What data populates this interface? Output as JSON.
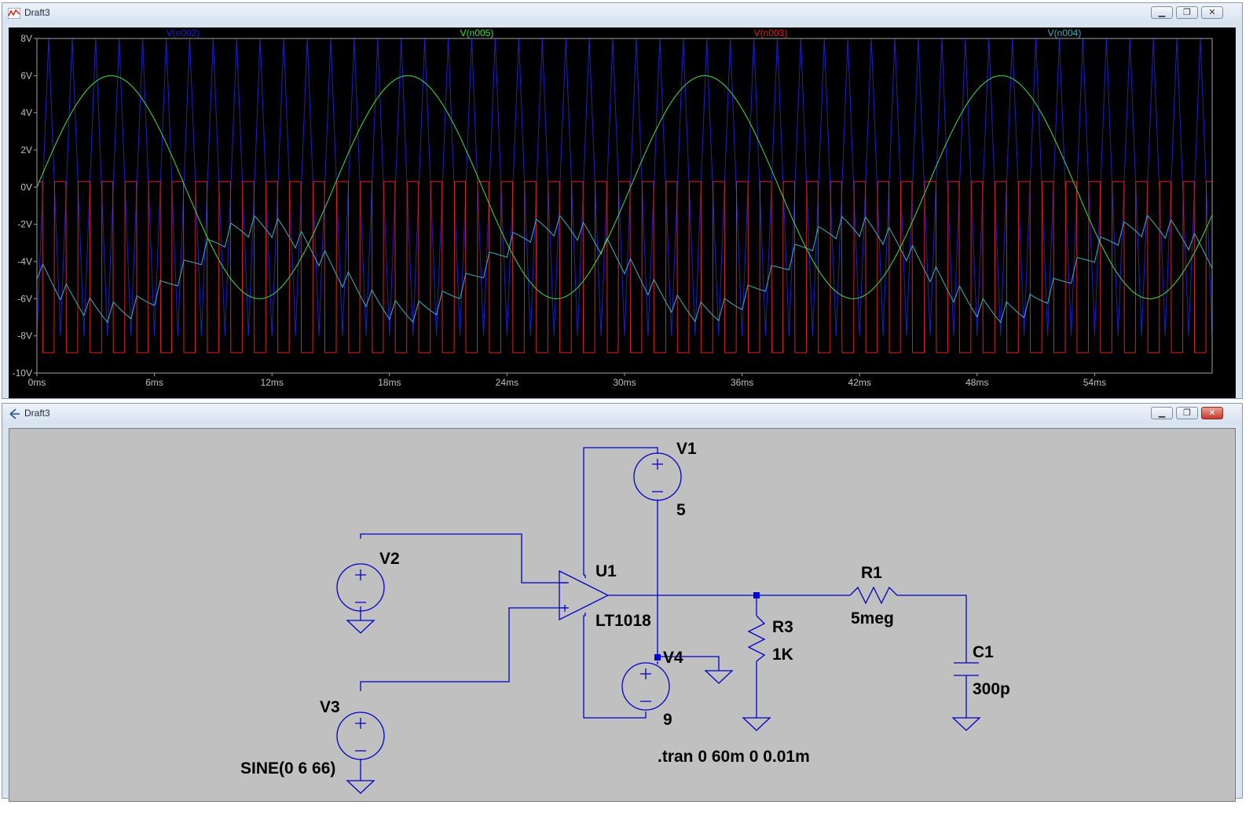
{
  "waveform_window": {
    "title": "Draft3",
    "traces": [
      {
        "name": "V(n002)",
        "color": "#2020c8"
      },
      {
        "name": "V(n005)",
        "color": "#40e040"
      },
      {
        "name": "V(n003)",
        "color": "#e02020"
      },
      {
        "name": "V(n004)",
        "color": "#40b0c0"
      }
    ],
    "y_ticks": [
      "8V",
      "6V",
      "4V",
      "2V",
      "0V",
      "-2V",
      "-4V",
      "-6V",
      "-8V",
      "-10V"
    ],
    "x_ticks": [
      "0ms",
      "6ms",
      "12ms",
      "18ms",
      "24ms",
      "30ms",
      "36ms",
      "42ms",
      "48ms",
      "54ms"
    ]
  },
  "chart_data": {
    "type": "line",
    "x_unit": "ms",
    "y_unit": "V",
    "xlim": [
      0,
      60
    ],
    "ylim": [
      -10,
      8
    ],
    "grid": false,
    "series": [
      {
        "name": "V(n002)",
        "description": "triangle",
        "min": -8,
        "max": 8,
        "period_ms": 1.2
      },
      {
        "name": "V(n005)",
        "description": "sine",
        "amplitude": 6,
        "frequency_hz": 66
      },
      {
        "name": "V(n003)",
        "description": "square",
        "low": -8.9,
        "high": 0.3,
        "period_ms": 1.2
      },
      {
        "name": "V(n004)",
        "description": "filtered sawtooth",
        "min": -7.5,
        "max": -1.3
      }
    ]
  },
  "schematic_window": {
    "title": "Draft3",
    "components": {
      "V1": {
        "label": "V1",
        "value": "5"
      },
      "V2": {
        "label": "V2"
      },
      "V3": {
        "label": "V3",
        "value": "SINE(0 6 66)"
      },
      "V4": {
        "label": "V4",
        "value": "9"
      },
      "U1": {
        "label": "U1",
        "value": "LT1018"
      },
      "R1": {
        "label": "R1",
        "value": "5meg"
      },
      "R3": {
        "label": "R3",
        "value": "1K"
      },
      "C1": {
        "label": "C1",
        "value": "300p"
      }
    },
    "directive": ".tran 0 60m 0 0.01m"
  },
  "colors": {
    "wire": "#0000c8",
    "plot_bg": "#000000",
    "schematic_bg": "#c0c0c0",
    "axis_text": "#c0c0c0"
  }
}
